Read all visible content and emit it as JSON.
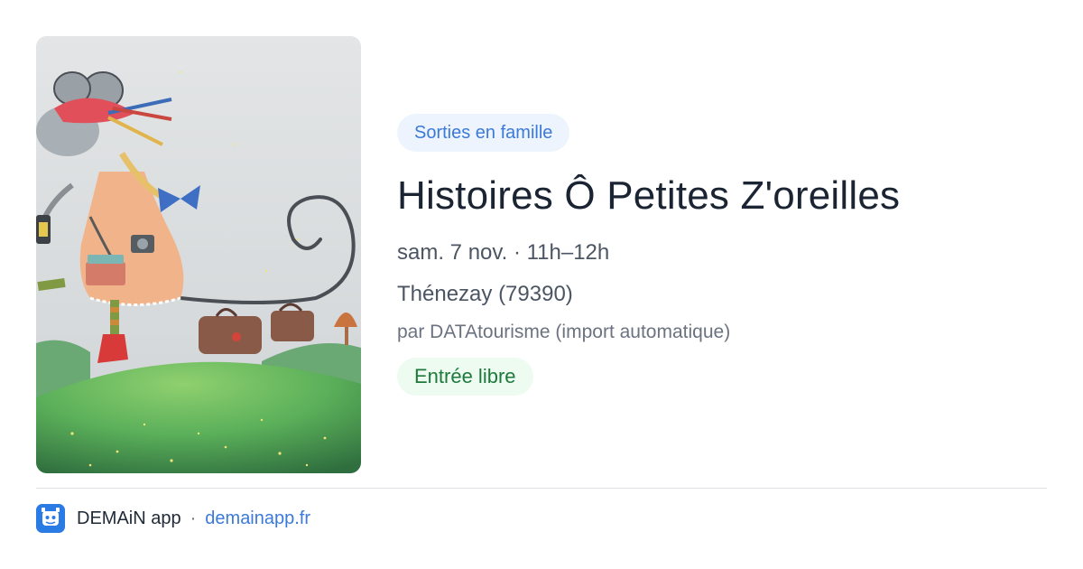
{
  "event": {
    "image_icon": "mouse-illustration",
    "category": "Sorties en famille",
    "title": "Histoires Ô Petites Z'oreilles",
    "datetime": "sam. 7 nov. · 11h–12h",
    "location": "Thénezay (79390)",
    "organizer": "par DATAtourisme (import automatique)",
    "price": "Entrée libre"
  },
  "footer": {
    "logo_icon": "demain-app-logo-icon",
    "app_name": "DEMAiN app",
    "separator": "·",
    "domain": "demainapp.fr"
  },
  "colors": {
    "accent_blue": "#3b7ad9",
    "category_bg": "#eef4fd",
    "price_green": "#1d7a3a",
    "price_bg": "#eefbf1"
  }
}
